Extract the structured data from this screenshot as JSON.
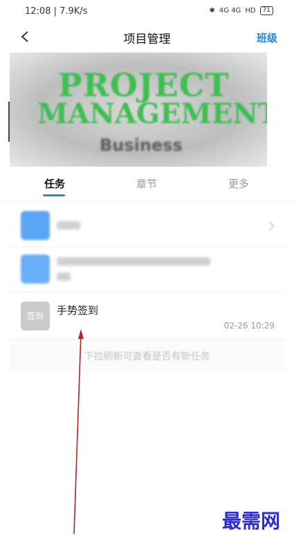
{
  "status_bar": {
    "time_speed": "12:08 | 7.9K/s",
    "signal_text": "4G 4G",
    "hd_badge": "HD",
    "battery": "71"
  },
  "nav": {
    "title": "项目管理",
    "right_action": "班级"
  },
  "banner": {
    "line1": "PROJECT",
    "line2": "MANAGEMENT",
    "line3": "Business"
  },
  "tabs": [
    {
      "label": "任务",
      "active": true
    },
    {
      "label": "章节",
      "active": false
    },
    {
      "label": "更多",
      "active": false
    }
  ],
  "tasks": {
    "checkin": {
      "icon_label": "签到",
      "title": "手势签到",
      "time": "02-26 10:29"
    }
  },
  "pull_hint": "下拉刷新可查看是否有新任务",
  "watermark": "最需网",
  "colors": {
    "accent": "#1e88e5",
    "annotation_arrow": "#b22222"
  }
}
